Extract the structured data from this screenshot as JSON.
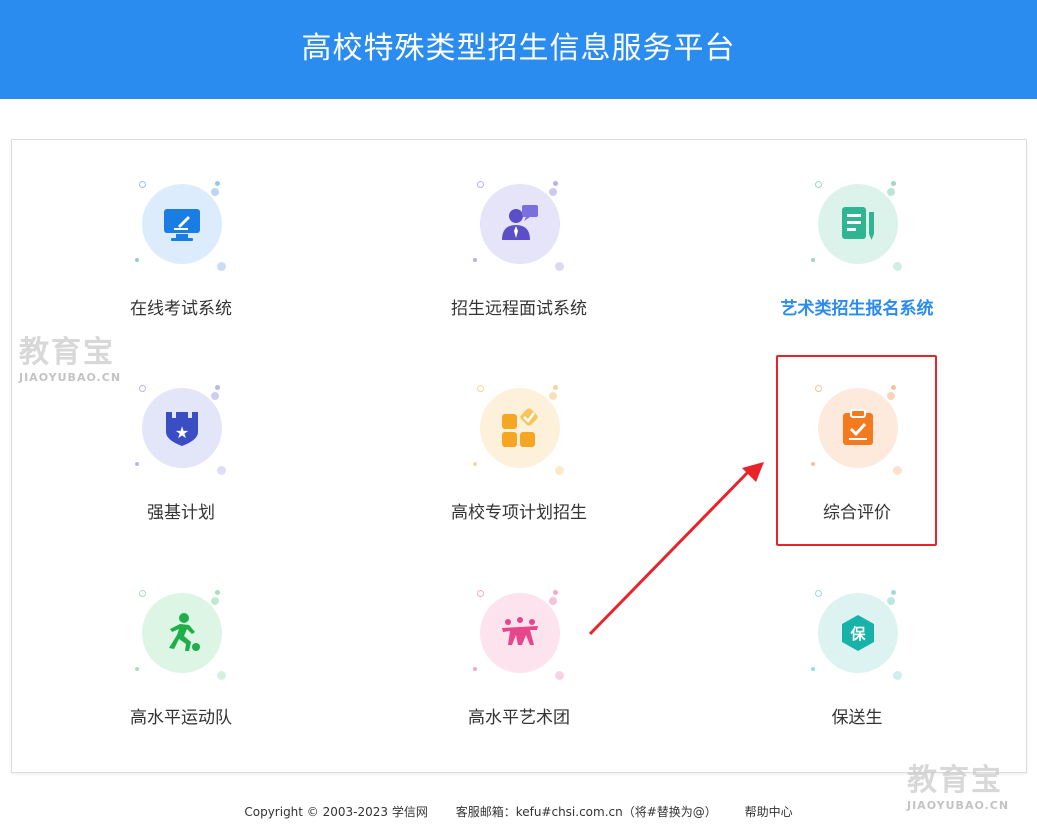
{
  "header": {
    "title": "高校特殊类型招生信息服务平台"
  },
  "tiles": [
    {
      "label": "在线考试系统"
    },
    {
      "label": "招生远程面试系统"
    },
    {
      "label": "艺术类招生报名系统"
    },
    {
      "label": "强基计划"
    },
    {
      "label": "高校专项计划招生"
    },
    {
      "label": "综合评价"
    },
    {
      "label": "高水平运动队"
    },
    {
      "label": "高水平艺术团"
    },
    {
      "label": "保送生"
    }
  ],
  "icons": {
    "shield_glyph": "★",
    "baosong_glyph": "保"
  },
  "footer": {
    "copyright": "Copyright © 2003-2023 学信网",
    "email": "客服邮箱：kefu#chsi.com.cn（将#替换为@）",
    "help": "帮助中心"
  },
  "watermark": {
    "big": "教育宝",
    "small": "JIAOYUBAO.CN"
  },
  "colors": {
    "header": "#2b8cf0",
    "active": "#2b8cf0",
    "highlight": "#e8242b"
  }
}
